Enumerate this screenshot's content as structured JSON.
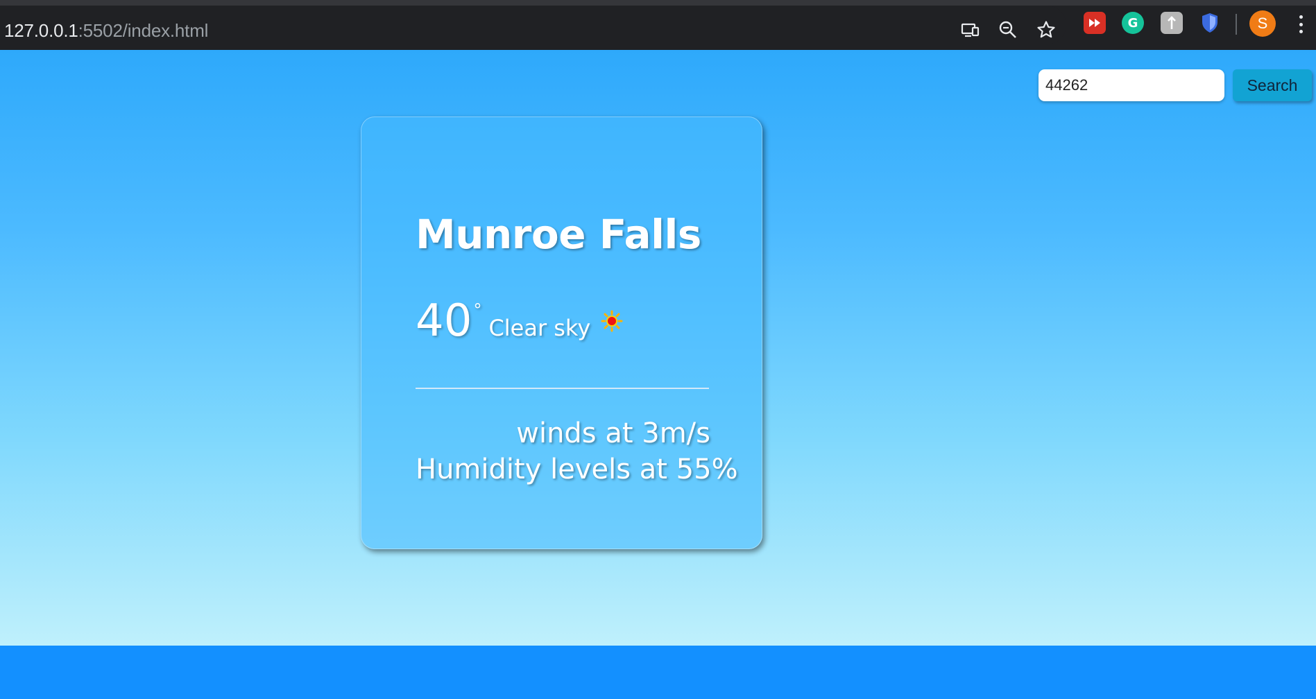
{
  "browser": {
    "url_host": "127.0.0.1",
    "url_path": ":5502/index.html",
    "toolbar_icons": [
      "cast-device-icon",
      "zoom-icon",
      "bookmark-star-icon"
    ],
    "extensions": [
      {
        "name": "red-extension-icon",
        "color": "#d93025"
      },
      {
        "name": "grammarly-extension-icon",
        "color": "#15c39a",
        "glyph": "G"
      },
      {
        "name": "gray-extension-icon",
        "color": "#b7b7b7"
      },
      {
        "name": "shield-extension-icon",
        "color": "#3b6be0"
      }
    ],
    "avatar_initial": "S",
    "avatar_color": "#f07c16"
  },
  "search": {
    "value": "44262",
    "button_label": "Search"
  },
  "weather": {
    "city": "Munroe Falls",
    "temperature": "40",
    "degree_symbol": "°",
    "description": "Clear sky",
    "icon": "sun-icon",
    "wind": "winds at 3m/s",
    "humidity": "Humidity levels at 55%"
  },
  "colors": {
    "sky_top": "#2ea9fb",
    "sky_bottom": "#bff0fc",
    "bottom_strip": "#1390ff",
    "search_button": "#12a3d3"
  }
}
